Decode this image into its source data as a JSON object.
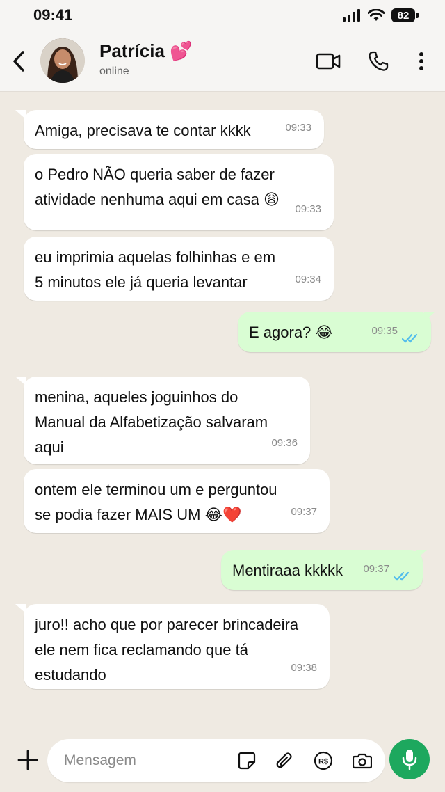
{
  "status_bar": {
    "time": "09:41",
    "battery": "82"
  },
  "header": {
    "contact_name": "Patrícia 💕",
    "contact_status": "online"
  },
  "messages": [
    {
      "dir": "in",
      "lines": [
        "Amiga, precisava te contar kkkk"
      ],
      "time": "09:33"
    },
    {
      "dir": "in",
      "lines": [
        "o Pedro NÃO queria saber de fazer",
        "atividade nenhuma aqui em casa 😩"
      ],
      "time": "09:33"
    },
    {
      "dir": "in",
      "lines": [
        "eu imprimia aquelas folhinhas e em",
        "5 minutos ele já queria levantar"
      ],
      "time": "09:34"
    },
    {
      "dir": "out",
      "lines": [
        "E agora? 😂"
      ],
      "time": "09:35"
    },
    {
      "dir": "in",
      "lines": [
        "menina, aqueles joguinhos do",
        "Manual da Alfabetização salvaram",
        "aqui"
      ],
      "time": "09:36"
    },
    {
      "dir": "in",
      "lines": [
        "ontem ele terminou um e perguntou",
        "se podia fazer MAIS UM 😂❤️"
      ],
      "time": "09:37"
    },
    {
      "dir": "out",
      "lines": [
        "Mentiraaa kkkkk"
      ],
      "time": "09:37"
    },
    {
      "dir": "in",
      "lines": [
        "juro!! acho que por parecer brincadeira",
        "ele nem fica reclamando que tá",
        "estudando"
      ],
      "time": "09:38"
    }
  ],
  "composer": {
    "placeholder": "Mensagem"
  },
  "icons": {
    "back": "chevron-left-icon",
    "video": "video-camera-icon",
    "call": "phone-icon",
    "menu": "more-vertical-icon",
    "attach_plus": "plus-icon",
    "sticker": "sticker-icon",
    "attach": "paperclip-icon",
    "payment": "pix-rs-icon",
    "camera": "camera-icon",
    "mic": "microphone-icon"
  },
  "colors": {
    "incoming_bubble": "#ffffff",
    "outgoing_bubble": "#d9fdd3",
    "chat_background": "#efeae2",
    "read_ticks": "#53bdeb",
    "mic_button": "#1da85e"
  }
}
